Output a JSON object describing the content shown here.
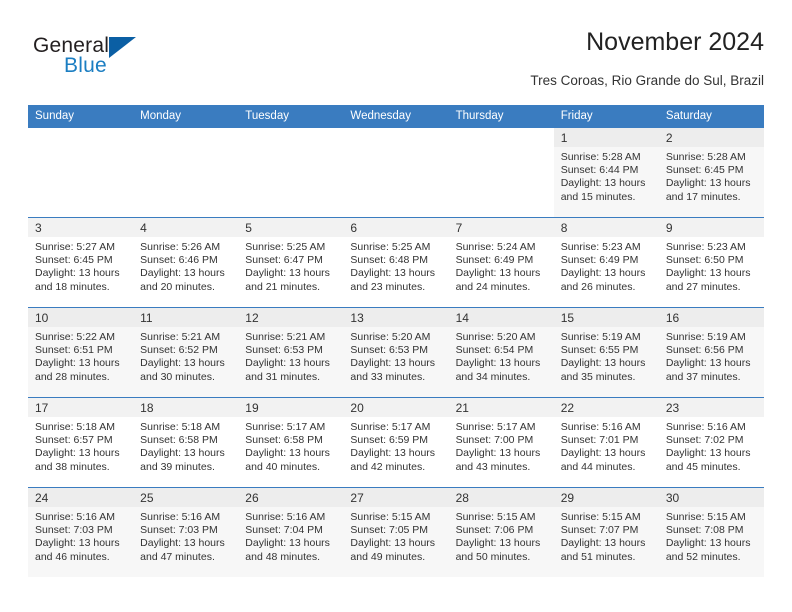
{
  "brand": {
    "name_top": "General",
    "name_bottom": "Blue",
    "accent_color": "#1b7ec2",
    "triangle_color": "#0b5fa4"
  },
  "header": {
    "title": "November 2024",
    "subtitle": "Tres Coroas, Rio Grande do Sul, Brazil"
  },
  "theme": {
    "header_row_color": "#3a7cc0",
    "row_shade_color": "#f7f7f7",
    "daynum_shade_color": "#ededed"
  },
  "weekdays": [
    "Sunday",
    "Monday",
    "Tuesday",
    "Wednesday",
    "Thursday",
    "Friday",
    "Saturday"
  ],
  "labels": {
    "sunrise": "Sunrise:",
    "sunset": "Sunset:",
    "daylight": "Daylight:"
  },
  "weeks": [
    {
      "shaded": true,
      "days": [
        {
          "date": "",
          "empty": true
        },
        {
          "date": "",
          "empty": true
        },
        {
          "date": "",
          "empty": true
        },
        {
          "date": "",
          "empty": true
        },
        {
          "date": "",
          "empty": true
        },
        {
          "date": "1",
          "sunrise": "Sunrise: 5:28 AM",
          "sunset": "Sunset: 6:44 PM",
          "daylight1": "Daylight: 13 hours",
          "daylight2": "and 15 minutes."
        },
        {
          "date": "2",
          "sunrise": "Sunrise: 5:28 AM",
          "sunset": "Sunset: 6:45 PM",
          "daylight1": "Daylight: 13 hours",
          "daylight2": "and 17 minutes."
        }
      ]
    },
    {
      "shaded": false,
      "days": [
        {
          "date": "3",
          "sunrise": "Sunrise: 5:27 AM",
          "sunset": "Sunset: 6:45 PM",
          "daylight1": "Daylight: 13 hours",
          "daylight2": "and 18 minutes."
        },
        {
          "date": "4",
          "sunrise": "Sunrise: 5:26 AM",
          "sunset": "Sunset: 6:46 PM",
          "daylight1": "Daylight: 13 hours",
          "daylight2": "and 20 minutes."
        },
        {
          "date": "5",
          "sunrise": "Sunrise: 5:25 AM",
          "sunset": "Sunset: 6:47 PM",
          "daylight1": "Daylight: 13 hours",
          "daylight2": "and 21 minutes."
        },
        {
          "date": "6",
          "sunrise": "Sunrise: 5:25 AM",
          "sunset": "Sunset: 6:48 PM",
          "daylight1": "Daylight: 13 hours",
          "daylight2": "and 23 minutes."
        },
        {
          "date": "7",
          "sunrise": "Sunrise: 5:24 AM",
          "sunset": "Sunset: 6:49 PM",
          "daylight1": "Daylight: 13 hours",
          "daylight2": "and 24 minutes."
        },
        {
          "date": "8",
          "sunrise": "Sunrise: 5:23 AM",
          "sunset": "Sunset: 6:49 PM",
          "daylight1": "Daylight: 13 hours",
          "daylight2": "and 26 minutes."
        },
        {
          "date": "9",
          "sunrise": "Sunrise: 5:23 AM",
          "sunset": "Sunset: 6:50 PM",
          "daylight1": "Daylight: 13 hours",
          "daylight2": "and 27 minutes."
        }
      ]
    },
    {
      "shaded": true,
      "days": [
        {
          "date": "10",
          "sunrise": "Sunrise: 5:22 AM",
          "sunset": "Sunset: 6:51 PM",
          "daylight1": "Daylight: 13 hours",
          "daylight2": "and 28 minutes."
        },
        {
          "date": "11",
          "sunrise": "Sunrise: 5:21 AM",
          "sunset": "Sunset: 6:52 PM",
          "daylight1": "Daylight: 13 hours",
          "daylight2": "and 30 minutes."
        },
        {
          "date": "12",
          "sunrise": "Sunrise: 5:21 AM",
          "sunset": "Sunset: 6:53 PM",
          "daylight1": "Daylight: 13 hours",
          "daylight2": "and 31 minutes."
        },
        {
          "date": "13",
          "sunrise": "Sunrise: 5:20 AM",
          "sunset": "Sunset: 6:53 PM",
          "daylight1": "Daylight: 13 hours",
          "daylight2": "and 33 minutes."
        },
        {
          "date": "14",
          "sunrise": "Sunrise: 5:20 AM",
          "sunset": "Sunset: 6:54 PM",
          "daylight1": "Daylight: 13 hours",
          "daylight2": "and 34 minutes."
        },
        {
          "date": "15",
          "sunrise": "Sunrise: 5:19 AM",
          "sunset": "Sunset: 6:55 PM",
          "daylight1": "Daylight: 13 hours",
          "daylight2": "and 35 minutes."
        },
        {
          "date": "16",
          "sunrise": "Sunrise: 5:19 AM",
          "sunset": "Sunset: 6:56 PM",
          "daylight1": "Daylight: 13 hours",
          "daylight2": "and 37 minutes."
        }
      ]
    },
    {
      "shaded": false,
      "days": [
        {
          "date": "17",
          "sunrise": "Sunrise: 5:18 AM",
          "sunset": "Sunset: 6:57 PM",
          "daylight1": "Daylight: 13 hours",
          "daylight2": "and 38 minutes."
        },
        {
          "date": "18",
          "sunrise": "Sunrise: 5:18 AM",
          "sunset": "Sunset: 6:58 PM",
          "daylight1": "Daylight: 13 hours",
          "daylight2": "and 39 minutes."
        },
        {
          "date": "19",
          "sunrise": "Sunrise: 5:17 AM",
          "sunset": "Sunset: 6:58 PM",
          "daylight1": "Daylight: 13 hours",
          "daylight2": "and 40 minutes."
        },
        {
          "date": "20",
          "sunrise": "Sunrise: 5:17 AM",
          "sunset": "Sunset: 6:59 PM",
          "daylight1": "Daylight: 13 hours",
          "daylight2": "and 42 minutes."
        },
        {
          "date": "21",
          "sunrise": "Sunrise: 5:17 AM",
          "sunset": "Sunset: 7:00 PM",
          "daylight1": "Daylight: 13 hours",
          "daylight2": "and 43 minutes."
        },
        {
          "date": "22",
          "sunrise": "Sunrise: 5:16 AM",
          "sunset": "Sunset: 7:01 PM",
          "daylight1": "Daylight: 13 hours",
          "daylight2": "and 44 minutes."
        },
        {
          "date": "23",
          "sunrise": "Sunrise: 5:16 AM",
          "sunset": "Sunset: 7:02 PM",
          "daylight1": "Daylight: 13 hours",
          "daylight2": "and 45 minutes."
        }
      ]
    },
    {
      "shaded": true,
      "days": [
        {
          "date": "24",
          "sunrise": "Sunrise: 5:16 AM",
          "sunset": "Sunset: 7:03 PM",
          "daylight1": "Daylight: 13 hours",
          "daylight2": "and 46 minutes."
        },
        {
          "date": "25",
          "sunrise": "Sunrise: 5:16 AM",
          "sunset": "Sunset: 7:03 PM",
          "daylight1": "Daylight: 13 hours",
          "daylight2": "and 47 minutes."
        },
        {
          "date": "26",
          "sunrise": "Sunrise: 5:16 AM",
          "sunset": "Sunset: 7:04 PM",
          "daylight1": "Daylight: 13 hours",
          "daylight2": "and 48 minutes."
        },
        {
          "date": "27",
          "sunrise": "Sunrise: 5:15 AM",
          "sunset": "Sunset: 7:05 PM",
          "daylight1": "Daylight: 13 hours",
          "daylight2": "and 49 minutes."
        },
        {
          "date": "28",
          "sunrise": "Sunrise: 5:15 AM",
          "sunset": "Sunset: 7:06 PM",
          "daylight1": "Daylight: 13 hours",
          "daylight2": "and 50 minutes."
        },
        {
          "date": "29",
          "sunrise": "Sunrise: 5:15 AM",
          "sunset": "Sunset: 7:07 PM",
          "daylight1": "Daylight: 13 hours",
          "daylight2": "and 51 minutes."
        },
        {
          "date": "30",
          "sunrise": "Sunrise: 5:15 AM",
          "sunset": "Sunset: 7:08 PM",
          "daylight1": "Daylight: 13 hours",
          "daylight2": "and 52 minutes."
        }
      ]
    }
  ]
}
